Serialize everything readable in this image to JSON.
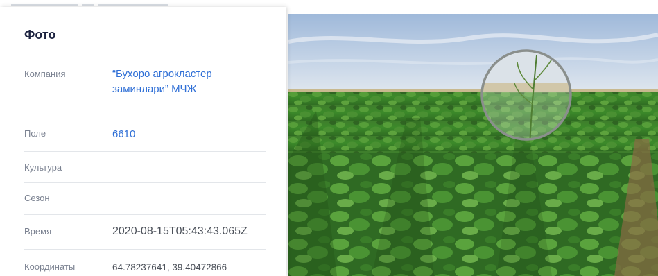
{
  "panel": {
    "title": "Фото",
    "rows": {
      "company": {
        "label": "Компания",
        "value": "“Бухоро агрокластер заминлари” МЧЖ"
      },
      "field": {
        "label": "Поле",
        "value": "6610"
      },
      "crop": {
        "label": "Культура",
        "value": ""
      },
      "season": {
        "label": "Сезон",
        "value": ""
      },
      "time": {
        "label": "Время",
        "value": "2020-08-15T05:43:43.065Z"
      },
      "coords": {
        "label": "Координаты",
        "value": "64.78237641, 39.40472866"
      }
    }
  },
  "colors": {
    "title": "#1d2340",
    "link": "#2f6fd6",
    "label": "#7a8190",
    "divider": "#e3e6ea"
  }
}
